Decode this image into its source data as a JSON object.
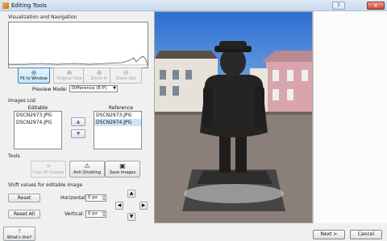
{
  "window": {
    "title": "Editing Tools",
    "help_glyph": "?",
    "close_glyph": "x"
  },
  "left": {
    "viz_label": "Visualization and Navigation",
    "toolbar": [
      {
        "label": "Fit to Window",
        "icon": "zoom-fit-icon",
        "glyph": "⊕",
        "active": true
      },
      {
        "label": "Original Size",
        "icon": "zoom-original-icon",
        "glyph": "⊕",
        "active": false
      },
      {
        "label": "Zoom In",
        "icon": "zoom-in-icon",
        "glyph": "⊕",
        "active": false
      },
      {
        "label": "Zoom Out",
        "icon": "zoom-out-icon",
        "glyph": "⊖",
        "active": false
      }
    ],
    "preview_mode_label": "Preview Mode:",
    "preview_mode_value": "Difference (E-P)",
    "images_list_label": "Images List",
    "editable_label": "Editable",
    "reference_label": "Reference",
    "editable_items": [
      "DSCN2973.JPG",
      "DSCN2974.JPG"
    ],
    "reference_items": [
      "DSCN2973.JPG",
      "DSCN2974.JPG"
    ],
    "reference_selected_index": 1,
    "tools_label": "Tools",
    "tools": [
      {
        "label": "Crop All Images",
        "icon": "crop-icon",
        "glyph": "⌗",
        "disabled": true
      },
      {
        "label": "Anti Ghosting",
        "icon": "anti-ghosting-icon",
        "glyph": "⚠",
        "disabled": false
      },
      {
        "label": "Save Images",
        "icon": "save-icon",
        "glyph": "▣",
        "disabled": false
      }
    ],
    "shift_label": "Shift values for editable image",
    "reset_label": "Reset",
    "reset_all_label": "Reset All",
    "horizontal_label": "Horizontal:",
    "horizontal_value": "0 px",
    "vertical_label": "Vertical:",
    "vertical_value": "0 px"
  },
  "footer": {
    "whats_this": "What's this?",
    "next": "Next >",
    "cancel": "Cancel"
  },
  "colors": {
    "accent": "#3c7fb1",
    "selection": "#cde3f7"
  }
}
